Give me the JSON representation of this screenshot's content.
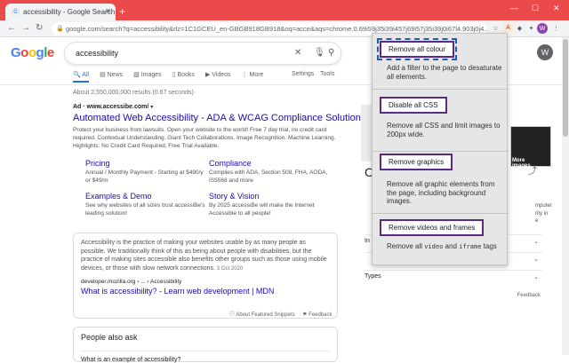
{
  "browser": {
    "tab_title": "accessibility - Google Search",
    "new_tab": "+",
    "url": "google.com/search?q=accessibility&rlz=1C1GCEU_en-GBGB918GB918&oq=acce&aqs=chrome.0.69i59j35i39i457j69i57j35i39j0i67l4.903j0j4...",
    "profile_initial": "W"
  },
  "google": {
    "logo_letters": [
      "G",
      "o",
      "o",
      "g",
      "l",
      "e"
    ],
    "query": "accessibility",
    "avatar_initial": "W",
    "tabs": [
      "All",
      "News",
      "Images",
      "Books",
      "Videos",
      "More"
    ],
    "settings": "Settings",
    "tools": "Tools",
    "stats": "About 2,550,000,000 results (0.67 seconds)"
  },
  "ad": {
    "label": "Ad · www.accessibe.com/",
    "title": "Automated Web Accessibility - ADA & WCAG Compliance Solution",
    "desc": "Protect your business from lawsuits. Open your website to the world! Free 7 day trial, no credit card required. Contextual Understanding. Giant Tech Collaborations. Image Recognition. Machine Learning. Highlights: No Credit Card Required, Free Trial Available.",
    "sitelinks": [
      {
        "title": "Pricing",
        "desc": "Annual / Monthly Payment - Starting at $490/y or $49/m"
      },
      {
        "title": "Compliance",
        "desc": "Complies with ADA, Section 508, FHA, AODA, IS5568 and more"
      },
      {
        "title": "Examples & Demo",
        "desc": "See why websites of all sizes trust accessiBe's leading solution!"
      },
      {
        "title": "Story & Vision",
        "desc": "By 2025 accessiBe will make the Internet Accessible to all people!"
      }
    ]
  },
  "snippet": {
    "body": "Accessibility is the practice of making your websites usable by as many people as possible. We traditionally think of this as being about people with disabilities, but the practice of making sites accessible also benefits other groups such as those using mobile devices, or those with slow network connections.",
    "date": "3 Oct 2020",
    "source": "developer.mozilla.org › ... › Accessibility",
    "link": "What is accessibility? - Learn web development | MDN",
    "about": "About Featured Snippets",
    "feedback": "Feedback"
  },
  "paa": {
    "title": "People also ask",
    "first_q": "What is an example of accessibility?"
  },
  "knowledge": {
    "letter": "C",
    "more_images": "More images",
    "text_lines": [
      "mputer",
      "rity in",
      "e"
    ],
    "rows": [
      "In",
      "",
      "Types"
    ],
    "feedback": "Feedback"
  },
  "extension": {
    "sections": [
      {
        "button": "Remove all colour",
        "desc": "Add a filter to the page to desaturate all elements."
      },
      {
        "button": "Disable all CSS",
        "desc": "Remove all CSS and limit images to 200px wide."
      },
      {
        "button": "Remove graphics",
        "desc": "Remove all graphic elements from the page, including background images."
      },
      {
        "button": "Remove videos and frames",
        "desc_pre": "Remove all ",
        "code1": "video",
        "desc_mid": " and ",
        "code2": "iframe",
        "desc_post": " tags"
      }
    ]
  }
}
